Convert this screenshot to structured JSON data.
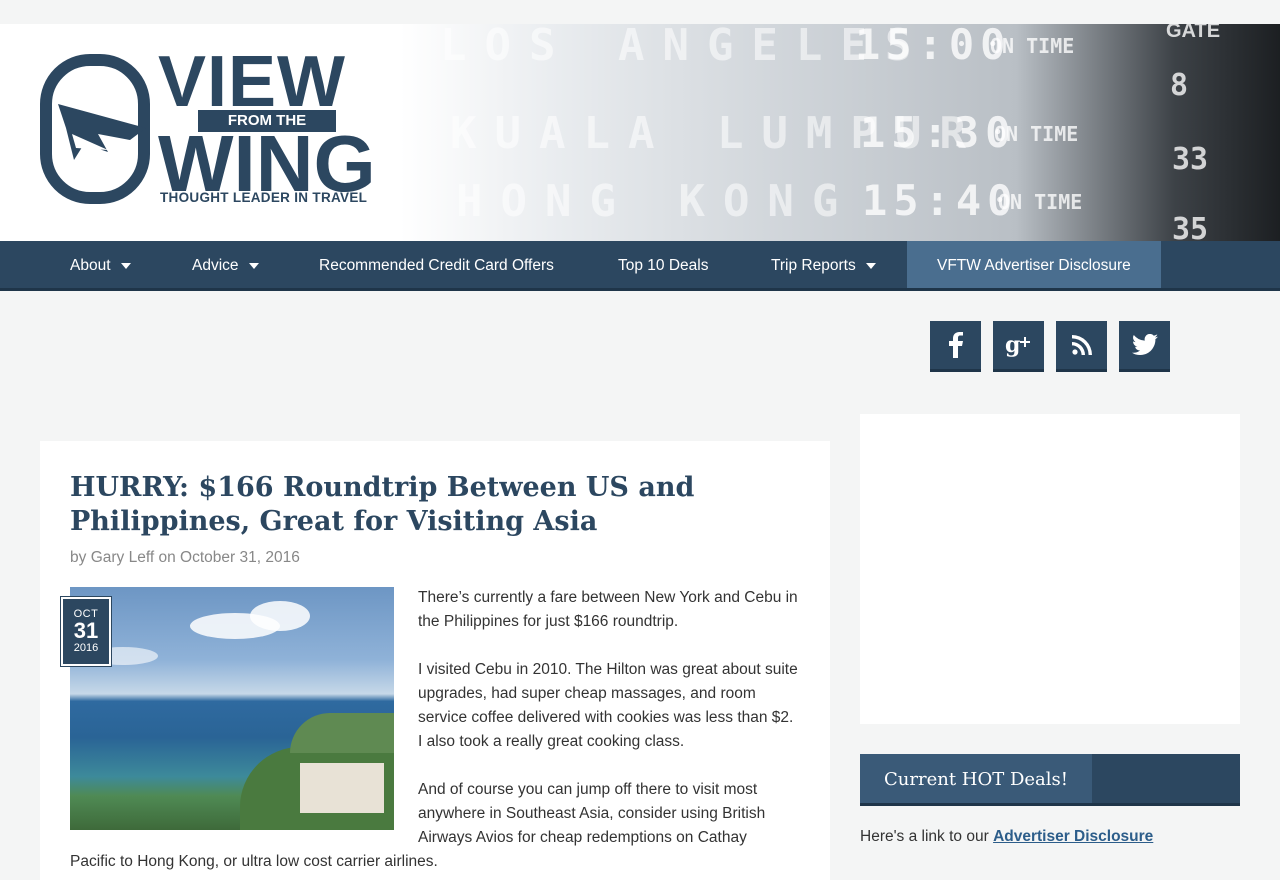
{
  "header": {
    "logo": {
      "line1": "VIEW",
      "line2": "FROM THE",
      "line3": "WING",
      "tagline": "THOUGHT LEADER IN TRAVEL"
    },
    "board": {
      "gate_label": "GATE",
      "rows": [
        {
          "city": "LOS ANGELES",
          "time": "15:00",
          "status": "ON TIME",
          "gate": "8"
        },
        {
          "city": "KUALA LUMPUR",
          "time": "15:30",
          "status": "ON TIME",
          "gate": "33"
        },
        {
          "city": "HONG KONG",
          "time": "15:40",
          "status": "ON TIME",
          "gate": "35"
        }
      ]
    }
  },
  "nav": {
    "items": [
      {
        "label": "About",
        "dropdown": true
      },
      {
        "label": "Advice",
        "dropdown": true
      },
      {
        "label": "Recommended Credit Card Offers",
        "dropdown": false
      },
      {
        "label": "Top 10 Deals",
        "dropdown": false
      },
      {
        "label": "Trip Reports",
        "dropdown": true
      },
      {
        "label": "VFTW Advertiser Disclosure",
        "dropdown": false
      }
    ]
  },
  "social": {
    "icons": [
      "facebook-icon",
      "google-plus-icon",
      "rss-icon",
      "twitter-icon"
    ]
  },
  "article": {
    "title": "HURRY: $166 Roundtrip Between US and Philippines, Great for Visiting Asia",
    "by": "by",
    "author": "Gary Leff",
    "on": "on",
    "date": "October 31, 2016",
    "badge": {
      "month": "OCT",
      "day": "31",
      "year": "2016"
    },
    "paragraphs": [
      "There’s currently a fare between New York and Cebu in the Philippines for just $166 roundtrip.",
      "I visited Cebu in 2010. The Hilton was great about suite upgrades, had super cheap massages, and room service coffee delivered with cookies was less than $2. I also took a really great cooking class.",
      "And of course you can jump off there to visit most anywhere in Southeast Asia, consider using British Airways Avios for cheap redemptions on Cathay",
      "Pacific to Hong Kong, or ultra low cost carrier airlines."
    ]
  },
  "sidebar": {
    "widget_title": "Current HOT Deals!",
    "link_prefix": "Here's a link to our",
    "link_text": "Advertiser Disclosure"
  },
  "colors": {
    "brand": "#2c4760",
    "nav_active": "#4a6e8f",
    "link": "#2c5d8a"
  }
}
